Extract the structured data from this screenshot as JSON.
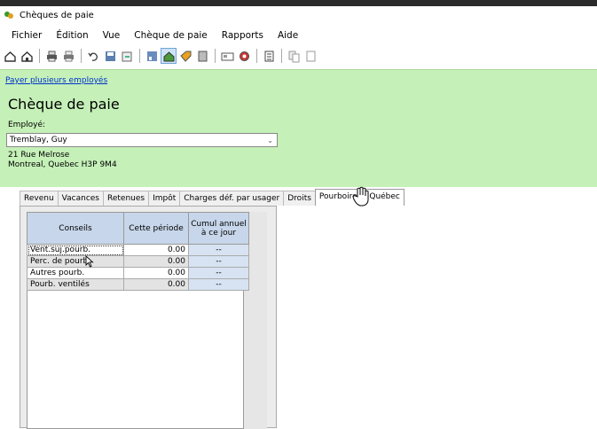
{
  "window": {
    "title": "Chèques de paie"
  },
  "menu": [
    "Fichier",
    "Édition",
    "Vue",
    "Chèque de paie",
    "Rapports",
    "Aide"
  ],
  "toolbar": [
    "home-icon",
    "house-icon",
    "print-icon",
    "print-preview-icon",
    "undo-icon",
    "save-icon",
    "export-icon",
    "dashboard-icon",
    "home-active-icon",
    "tag-icon",
    "calculator-icon",
    "card-icon",
    "gear-icon",
    "list-icon",
    "copy-icon",
    "page-icon"
  ],
  "header": {
    "link": "Payer plusieurs employés",
    "title": "Chèque de paie",
    "employee_label": "Employé:",
    "employee_value": "Tremblay, Guy",
    "address_line1": "21 Rue Melrose",
    "address_line2": "Montreal, Quebec H3P 9M4"
  },
  "tabs": [
    "Revenu",
    "Vacances",
    "Retenues",
    "Impôt",
    "Charges déf. par usager",
    "Droits",
    "Pourboires - Québec"
  ],
  "grid": {
    "col_conseils": "Conseils",
    "col_periode": "Cette période",
    "col_cumul": "Cumul annuel à ce jour",
    "rows": [
      {
        "label": "Vent.suj.pourb.",
        "value": "0.00",
        "cumul": "--"
      },
      {
        "label": "Perc. de pourb.",
        "value": "0.00",
        "cumul": "--"
      },
      {
        "label": "Autres pourb.",
        "value": "0.00",
        "cumul": "--"
      },
      {
        "label": "Pourb. ventilés",
        "value": "0.00",
        "cumul": "--"
      }
    ]
  },
  "colors": {
    "header_bg": "#c5f0b8",
    "grid_header_bg": "#c7d6ea",
    "link": "#0033cc"
  }
}
